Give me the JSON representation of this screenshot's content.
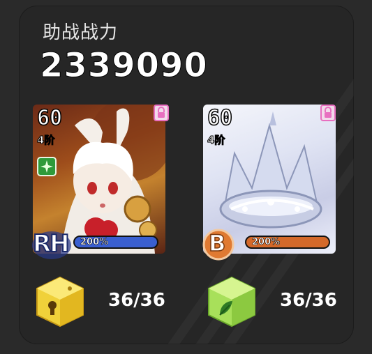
{
  "header": {
    "title": "助战战力",
    "power_value": "2339090"
  },
  "cards": [
    {
      "level": "60",
      "tier": "4阶",
      "rank_badge": "RH",
      "percent": "200%",
      "bar_color": "#3a5fd0",
      "element_icon": "green-sparkle-element-icon",
      "locked": true,
      "portrait": "white-haired-fox-girl-character"
    },
    {
      "level": "60",
      "tier": "4阶",
      "rank_badge": "B",
      "percent": "200%",
      "bar_color": "#d4692a",
      "locked": true,
      "portrait": "crystal-crown-item"
    }
  ],
  "resources": [
    {
      "icon": "yellow-keyhole-dice-icon",
      "count": "36/36"
    },
    {
      "icon": "green-leaf-dice-icon",
      "count": "36/36"
    }
  ],
  "colors": {
    "background": "#262626",
    "lock": "#e86fc0"
  }
}
